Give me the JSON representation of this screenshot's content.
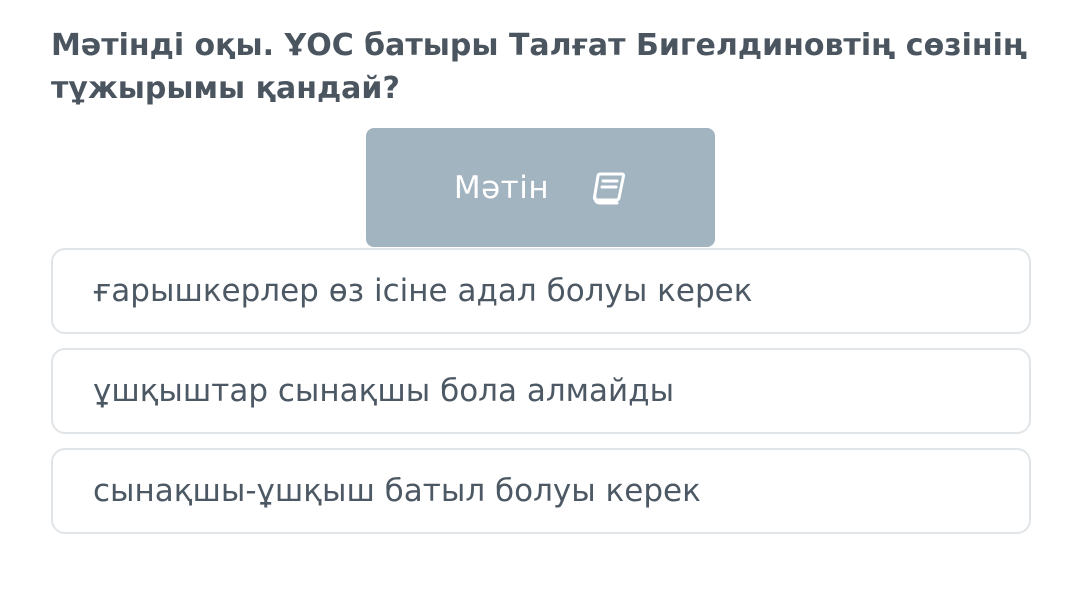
{
  "question": {
    "title": "Мәтінді оқы. ҰОС батыры Талғат Бигелдиновтің сөзінің тұжырымы қандай?"
  },
  "text_button": {
    "label": "Мәтін",
    "icon": "book-icon"
  },
  "options": [
    {
      "label": "ғарышкерлер өз ісіне адал болуы керек"
    },
    {
      "label": "ұшқыштар сынақшы бола алмайды"
    },
    {
      "label": "сынақшы-ұшқыш батыл болуы керек"
    }
  ],
  "colors": {
    "question_text": "#4a5560",
    "text_button_bg": "#a1b4c0",
    "option_border": "#e1e5e8",
    "option_text": "#4c5863"
  }
}
